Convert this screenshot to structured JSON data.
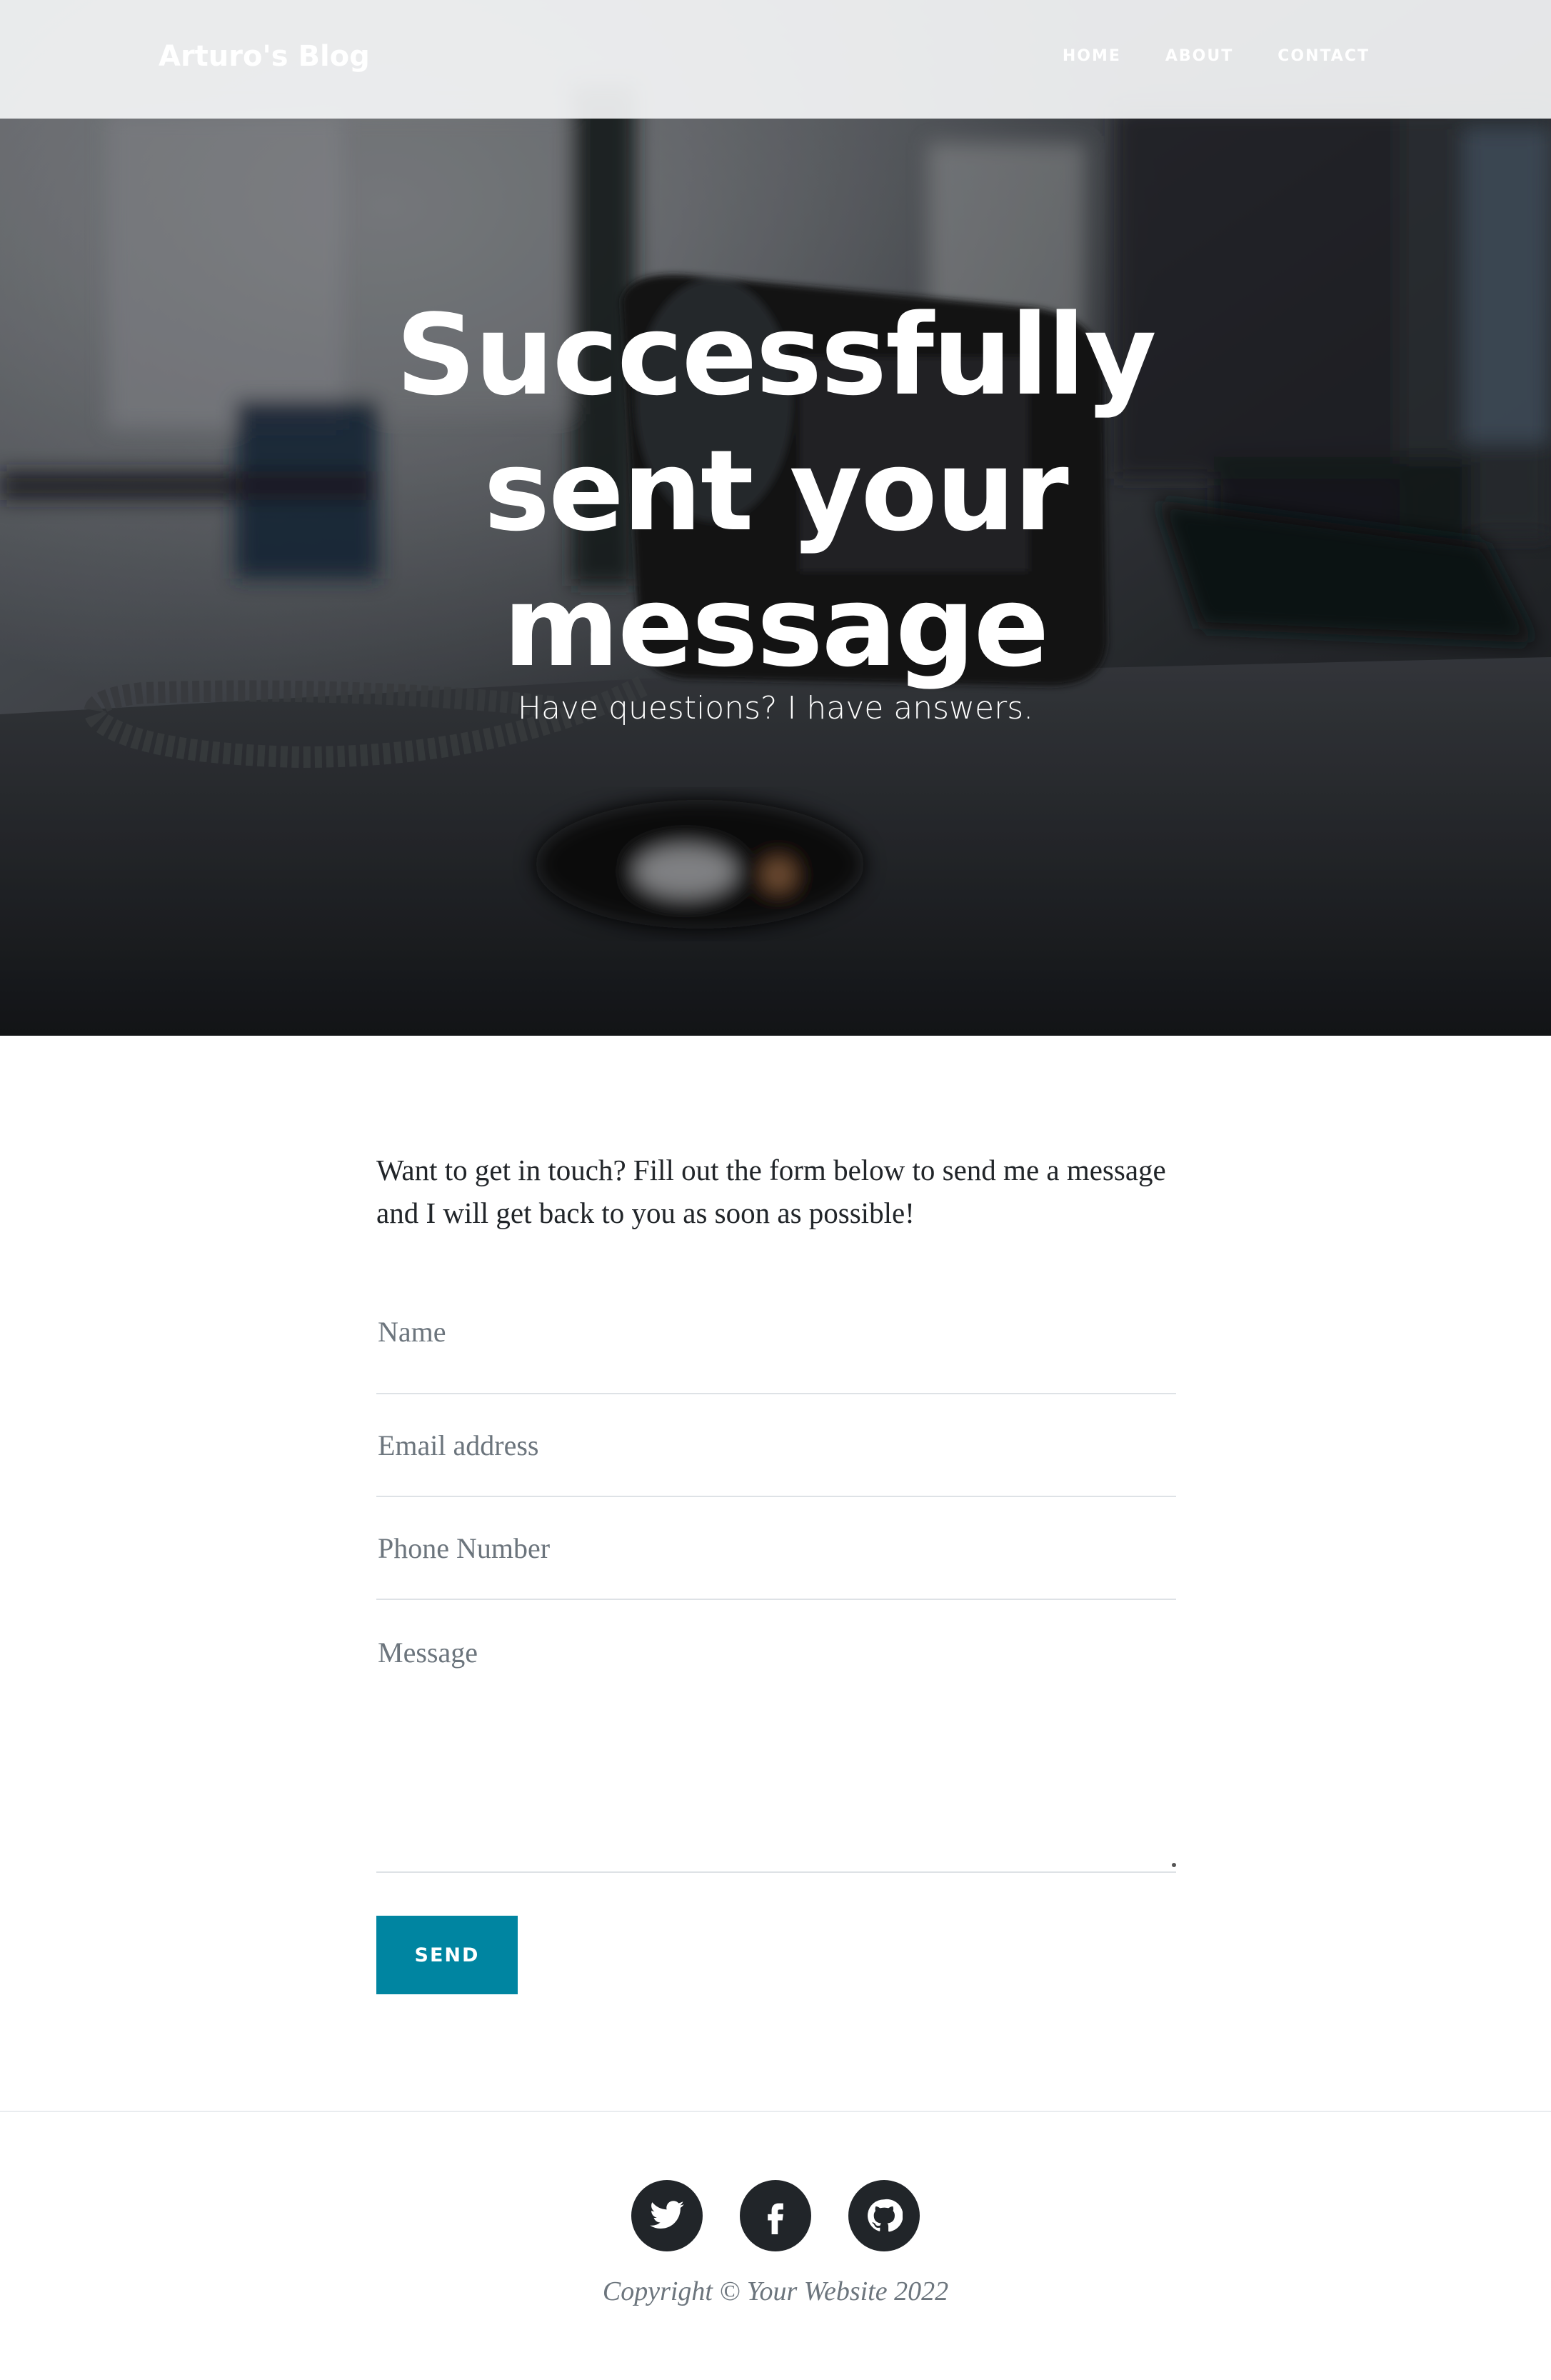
{
  "navbar": {
    "brand": "Arturo's Blog",
    "links": [
      {
        "label": "HOME"
      },
      {
        "label": "ABOUT"
      },
      {
        "label": "CONTACT"
      }
    ]
  },
  "hero": {
    "title": "Successfully sent your message",
    "subtitle": "Have questions? I have answers."
  },
  "contact": {
    "intro": "Want to get in touch? Fill out the form below to send me a message and I will get back to you as soon as possible!",
    "fields": {
      "name_placeholder": "Name",
      "email_placeholder": "Email address",
      "phone_placeholder": "Phone Number",
      "message_placeholder": "Message"
    },
    "send_label": "SEND"
  },
  "footer": {
    "social": [
      "twitter-icon",
      "facebook-icon",
      "github-icon"
    ],
    "copyright": "Copyright © Your Website 2022"
  },
  "colors": {
    "accent": "#0085a1",
    "dark": "#212529",
    "muted": "#6c757d"
  }
}
